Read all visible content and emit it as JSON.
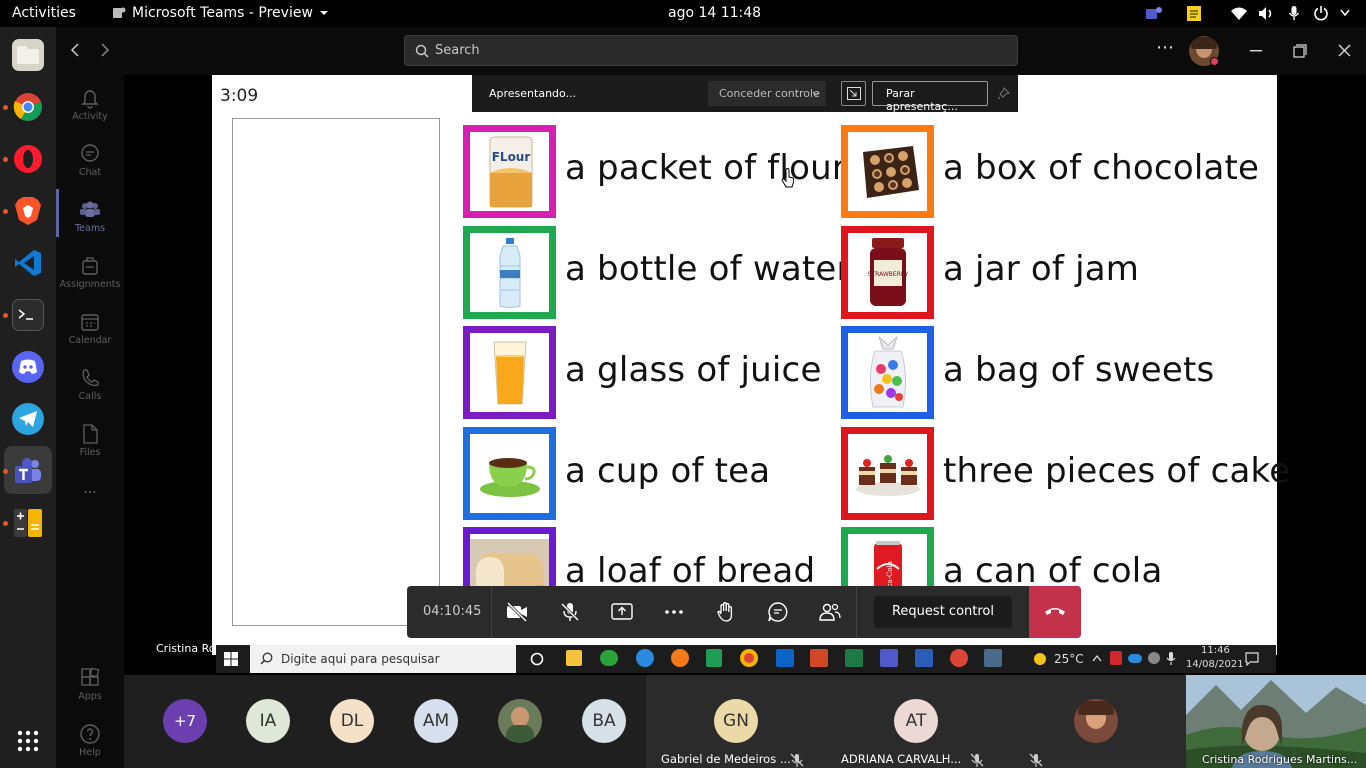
{
  "system": {
    "activities": "Activities",
    "app_title": "Microsoft Teams - Preview",
    "clock": "ago 14  11:48"
  },
  "teams": {
    "search_placeholder": "Search",
    "more": "⋯",
    "rail": [
      {
        "label": "Activity",
        "icon": "bell-icon"
      },
      {
        "label": "Chat",
        "icon": "chat-icon"
      },
      {
        "label": "Teams",
        "icon": "teams-icon"
      },
      {
        "label": "Assignments",
        "icon": "assignments-icon"
      },
      {
        "label": "Calendar",
        "icon": "calendar-icon"
      },
      {
        "label": "Calls",
        "icon": "phone-icon"
      },
      {
        "label": "Files",
        "icon": "file-icon"
      }
    ],
    "rail_more": "···",
    "apps_label": "Apps",
    "help_label": "Help"
  },
  "presenting": {
    "status": "Apresentando...",
    "give_control": "Conceder controle",
    "stop": "Parar apresentaç..."
  },
  "slide": {
    "timer": "3:09",
    "items_left": [
      {
        "text": "a packet of flour",
        "color": "#d61fb0",
        "icon": "flour-packet-icon"
      },
      {
        "text": "a bottle of water",
        "color": "#1ea84f",
        "icon": "water-bottle-icon"
      },
      {
        "text": "a glass of juice",
        "color": "#7a1cc2",
        "icon": "juice-glass-icon"
      },
      {
        "text": "a cup of tea",
        "color": "#1d6fe0",
        "icon": "tea-cup-icon"
      },
      {
        "text": "a loaf of bread",
        "color": "#6a1bd1",
        "icon": "bread-icon"
      }
    ],
    "items_right": [
      {
        "text": "a box of chocolate",
        "color": "#ff7a12",
        "icon": "chocolate-box-icon"
      },
      {
        "text": "a jar of jam",
        "color": "#e0161e",
        "icon": "jam-jar-icon"
      },
      {
        "text": "a bag of sweets",
        "color": "#1d60e6",
        "icon": "sweets-bag-icon"
      },
      {
        "text": "three pieces of cake",
        "color": "#e0161e",
        "icon": "cake-icon"
      },
      {
        "text": "a can of cola",
        "color": "#1ea84f",
        "icon": "cola-can-icon"
      }
    ]
  },
  "call": {
    "duration": "04:10:45",
    "request_control": "Request control"
  },
  "presenter_name": "Cristina Rodrigues Martins Lossio",
  "windows_taskbar": {
    "search": "Digite aqui para pesquisar",
    "temperature": "25°C",
    "time": "11:46",
    "date": "14/08/2021"
  },
  "participants": [
    {
      "initials": "+7",
      "color": "#6b3fb0"
    },
    {
      "initials": "IA",
      "color": "#dfe7d6"
    },
    {
      "initials": "DL",
      "color": "#f5e1c8"
    },
    {
      "initials": "AM",
      "color": "#d7deee"
    },
    {
      "initials": "",
      "color": "#6b7a5a"
    },
    {
      "initials": "BA",
      "color": "#d5e0e7"
    }
  ],
  "tiles": [
    {
      "initials": "GN",
      "name": "Gabriel de Medeiros ...",
      "color": "#ecd9a8"
    },
    {
      "initials": "AT",
      "name": "ADRIANA CARVALH...",
      "color": "#ecd9d6"
    },
    {
      "initials": "",
      "name": "",
      "color": "#8a5a4a"
    }
  ],
  "self_video_name": "Cristina Rodrigues Martins..."
}
